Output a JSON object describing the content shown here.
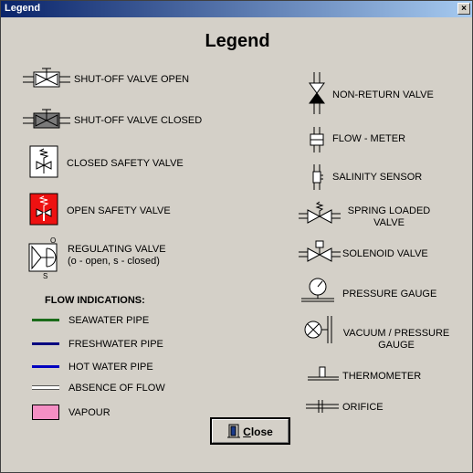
{
  "window": {
    "title": "Legend",
    "close_glyph": "×"
  },
  "heading": "Legend",
  "left_items": [
    {
      "label": "SHUT-OFF VALVE OPEN",
      "icon": "gate-valve-open-icon"
    },
    {
      "label": "SHUT-OFF VALVE CLOSED",
      "icon": "gate-valve-closed-icon"
    },
    {
      "label": "CLOSED SAFETY VALVE",
      "icon": "safety-valve-closed-icon"
    },
    {
      "label": "OPEN  SAFETY VALVE",
      "icon": "safety-valve-open-icon"
    },
    {
      "label_line1": "REGULATING VALVE",
      "label_line2": "(o - open, s - closed)",
      "icon": "regulating-valve-icon",
      "icon_top": "O",
      "icon_bottom": "S"
    }
  ],
  "flow": {
    "title": "FLOW INDICATIONS:",
    "items": [
      {
        "label": "SEAWATER PIPE",
        "color": "#1a6b1a"
      },
      {
        "label": "FRESHWATER PIPE",
        "color": "#000080"
      },
      {
        "label": "HOT WATER PIPE",
        "color": "#0000c0"
      },
      {
        "label": "ABSENCE OF FLOW",
        "color": "#ffffff"
      },
      {
        "label": "VAPOUR",
        "color": "#f48fc4"
      }
    ]
  },
  "right_items": [
    {
      "label": "NON-RETURN VALVE",
      "icon": "non-return-valve-icon"
    },
    {
      "label": "FLOW - METER",
      "icon": "flow-meter-icon"
    },
    {
      "label": "SALINITY SENSOR",
      "icon": "salinity-sensor-icon"
    },
    {
      "label_line1": "SPRING LOADED",
      "label_line2": "VALVE",
      "icon": "spring-loaded-valve-icon"
    },
    {
      "label": "SOLENOID VALVE",
      "icon": "solenoid-valve-icon"
    },
    {
      "label": "PRESSURE GAUGE",
      "icon": "pressure-gauge-icon"
    },
    {
      "label_line1": "VACUUM / PRESSURE",
      "label_line2": "GAUGE",
      "icon": "vacuum-pressure-gauge-icon"
    },
    {
      "label": "THERMOMETER",
      "icon": "thermometer-icon"
    },
    {
      "label": "ORIFICE",
      "icon": "orifice-icon"
    }
  ],
  "close_button": {
    "accel": "C",
    "rest": "lose",
    "icon": "door-icon"
  }
}
